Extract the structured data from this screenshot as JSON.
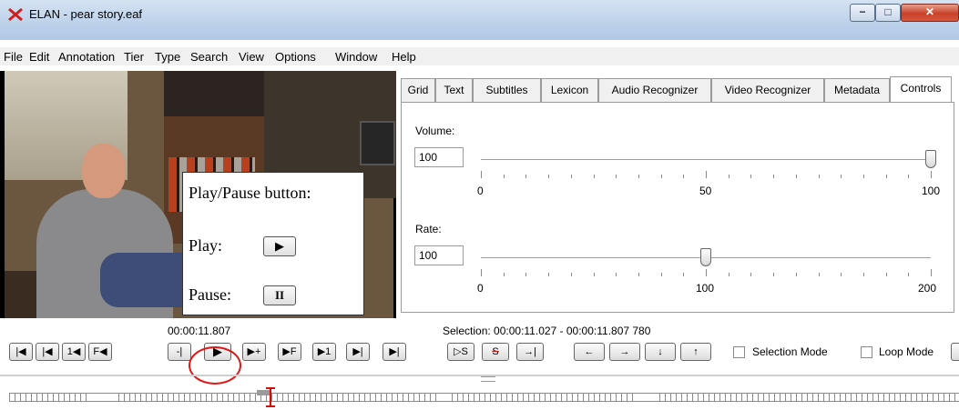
{
  "window": {
    "title": "ELAN - pear story.eaf",
    "minimize_glyph": "−",
    "maximize_glyph": "□",
    "close_glyph": "✕"
  },
  "menu": [
    "File",
    "Edit",
    "Annotation",
    "Tier",
    "Type",
    "Search",
    "View",
    "Options",
    "Window",
    "Help"
  ],
  "callout": {
    "title": "Play/Pause button:",
    "play_label": "Play:",
    "pause_label": "Pause:",
    "play_glyph": "▶",
    "pause_glyph": "II"
  },
  "tabs": [
    "Grid",
    "Text",
    "Subtitles",
    "Lexicon",
    "Audio Recognizer",
    "Video Recognizer",
    "Metadata",
    "Controls"
  ],
  "active_tab": "Controls",
  "volume": {
    "label": "Volume:",
    "value": "100",
    "min_label": "0",
    "mid_label": "50",
    "max_label": "100",
    "level": 100
  },
  "rate": {
    "label": "Rate:",
    "value": "100",
    "min_label": "0",
    "mid_label": "100",
    "max_label": "200",
    "level": 100
  },
  "time": "00:00:11.807",
  "selection": "Selection: 00:00:11.027 - 00:00:11.807  780",
  "buttons": {
    "b1": "|◀",
    "b2": "|◀",
    "b3": "1◀",
    "b4": "F◀",
    "b5": "-|",
    "b6": "▶",
    "b7": "▶+",
    "b8": "▶F",
    "b9": "▶1",
    "b10": "▶|",
    "b11": "▶|",
    "s1": "▷S",
    "s2": "S",
    "s3": "→|",
    "a1": "←",
    "a2": "→",
    "a3": "↓",
    "a4": "↑"
  },
  "selection_mode": "Selection Mode",
  "loop_mode": "Loop Mode"
}
